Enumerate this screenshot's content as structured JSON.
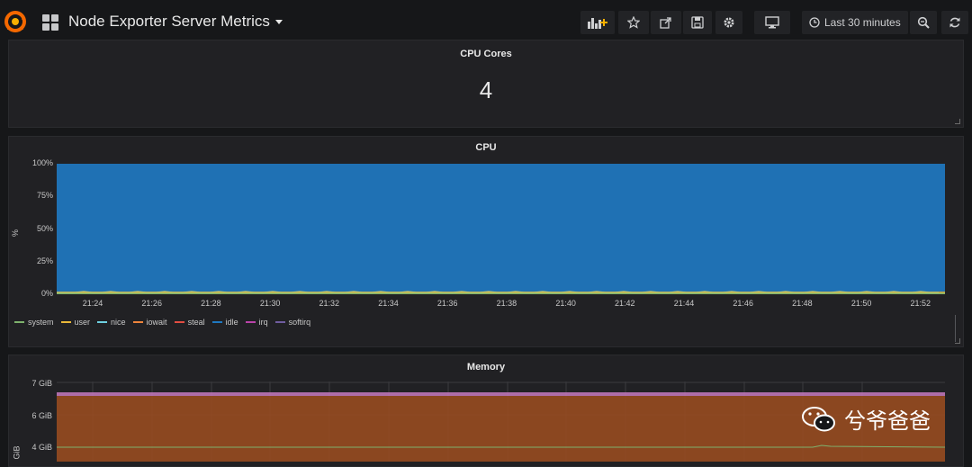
{
  "header": {
    "dashboard_title": "Node Exporter Server Metrics",
    "time_range": "Last 30 minutes"
  },
  "panels": {
    "cpu_cores": {
      "title": "CPU Cores",
      "value": "4"
    },
    "cpu": {
      "title": "CPU",
      "unit": "%",
      "y_ticks": [
        "100%",
        "75%",
        "50%",
        "25%",
        "0%"
      ],
      "x_ticks": [
        "21:24",
        "21:26",
        "21:28",
        "21:30",
        "21:32",
        "21:34",
        "21:36",
        "21:38",
        "21:40",
        "21:42",
        "21:44",
        "21:46",
        "21:48",
        "21:50",
        "21:52"
      ],
      "legend": [
        {
          "name": "system",
          "color": "#7eb26d"
        },
        {
          "name": "user",
          "color": "#eab839"
        },
        {
          "name": "nice",
          "color": "#6ed0e0"
        },
        {
          "name": "iowait",
          "color": "#ef843c"
        },
        {
          "name": "steal",
          "color": "#e24d42"
        },
        {
          "name": "idle",
          "color": "#1f78c1"
        },
        {
          "name": "irq",
          "color": "#ba43a9"
        },
        {
          "name": "softirq",
          "color": "#705da0"
        }
      ]
    },
    "memory": {
      "title": "Memory",
      "unit": "GiB",
      "y_ticks": [
        "7 GiB",
        "6 GiB",
        "4 GiB"
      ]
    }
  },
  "watermark": {
    "text": "兮爷爸爸"
  },
  "chart_data": [
    {
      "type": "area",
      "title": "CPU",
      "ylabel": "%",
      "ylim": [
        0,
        100
      ],
      "x": [
        "21:24",
        "21:26",
        "21:28",
        "21:30",
        "21:32",
        "21:34",
        "21:36",
        "21:38",
        "21:40",
        "21:42",
        "21:44",
        "21:46",
        "21:48",
        "21:50",
        "21:52"
      ],
      "stacked": true,
      "series": [
        {
          "name": "system",
          "values": [
            1,
            1,
            1,
            1,
            1,
            1,
            1,
            1,
            1,
            1,
            1,
            1,
            1,
            1,
            1
          ]
        },
        {
          "name": "user",
          "values": [
            1,
            1,
            1,
            1,
            1,
            1,
            1,
            1,
            1,
            1,
            1,
            1,
            1,
            1,
            1
          ]
        },
        {
          "name": "nice",
          "values": [
            0,
            0,
            0,
            0,
            0,
            0,
            0,
            0,
            0,
            0,
            0,
            0,
            0,
            0,
            0
          ]
        },
        {
          "name": "iowait",
          "values": [
            0,
            0,
            0,
            0,
            0,
            0,
            0,
            0,
            0,
            0,
            0,
            0,
            0,
            0,
            0
          ]
        },
        {
          "name": "steal",
          "values": [
            0,
            0,
            0,
            0,
            0,
            0,
            0,
            0,
            0,
            0,
            0,
            0,
            0,
            0,
            0
          ]
        },
        {
          "name": "idle",
          "values": [
            98,
            98,
            98,
            98,
            98,
            98,
            98,
            98,
            98,
            98,
            98,
            98,
            98,
            98,
            98
          ]
        },
        {
          "name": "irq",
          "values": [
            0,
            0,
            0,
            0,
            0,
            0,
            0,
            0,
            0,
            0,
            0,
            0,
            0,
            0,
            0
          ]
        },
        {
          "name": "softirq",
          "values": [
            0,
            0,
            0,
            0,
            0,
            0,
            0,
            0,
            0,
            0,
            0,
            0,
            0,
            0,
            0
          ]
        }
      ],
      "legend_position": "bottom-left",
      "grid": true
    },
    {
      "type": "area",
      "title": "Memory",
      "ylabel": "GiB",
      "y_ticks": [
        "7 GiB",
        "6 GiB",
        "4 GiB"
      ],
      "grid": true
    }
  ]
}
